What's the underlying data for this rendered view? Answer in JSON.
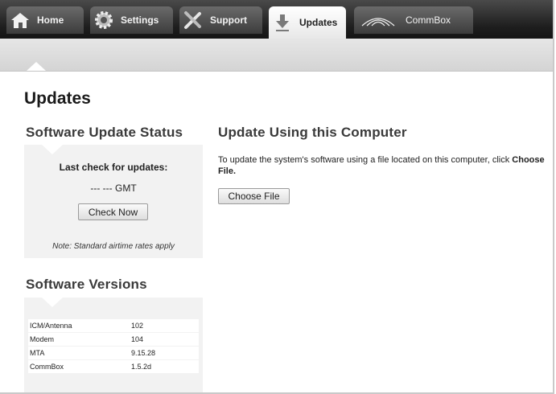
{
  "nav": {
    "tabs": [
      {
        "label": "Home",
        "icon": "home-icon"
      },
      {
        "label": "Settings",
        "icon": "gear-icon"
      },
      {
        "label": "Support",
        "icon": "tools-icon"
      },
      {
        "label": "Updates",
        "icon": "download-icon",
        "active": true
      },
      {
        "label": "CommBox",
        "icon": "signal-icon"
      }
    ]
  },
  "page": {
    "title": "Updates"
  },
  "status": {
    "title": "Software Update Status",
    "last_check_label": "Last check for updates:",
    "last_check_value": "---  --- GMT",
    "check_button": "Check Now",
    "note": "Note: Standard airtime rates apply"
  },
  "versions": {
    "title": "Software Versions",
    "rows": [
      {
        "name": "ICM/Antenna",
        "value": "102"
      },
      {
        "name": "Modem",
        "value": "104"
      },
      {
        "name": "MTA",
        "value": "9.15.28"
      },
      {
        "name": "CommBox",
        "value": "1.5.2d"
      }
    ]
  },
  "computer_update": {
    "title": "Update Using this Computer",
    "desc_text": "To update the system's software using a file located on this computer, click",
    "desc_bold": "Choose File.",
    "choose_button": "Choose File"
  },
  "colors": {
    "nav_bg": "#1e1e1e",
    "panel_bg": "#f2f2f2",
    "subbar_bg": "#dcdcdc"
  }
}
